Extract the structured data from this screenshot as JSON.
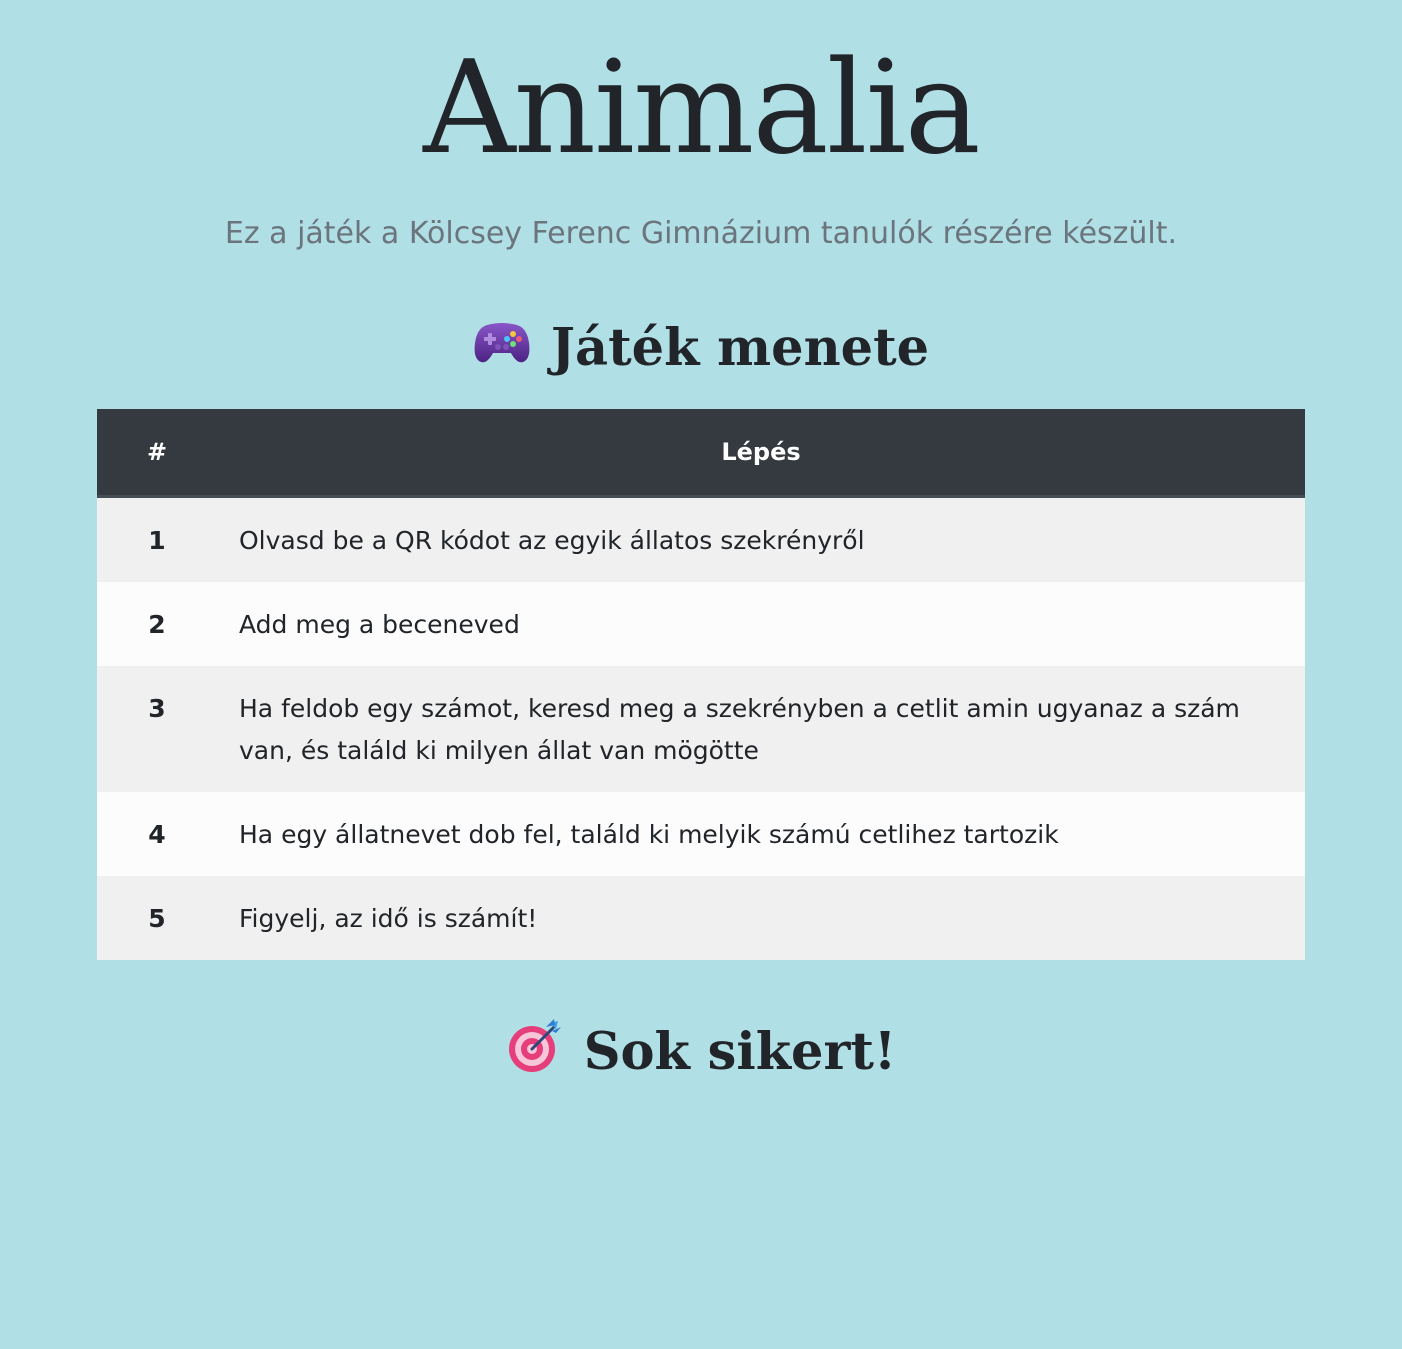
{
  "header": {
    "title": "Animalia",
    "subtitle": "Ez a játék a Kölcsey Ferenc Gimnázium tanulók részére készült."
  },
  "game_section": {
    "icon": "game-controller-icon",
    "title": "Játék menete"
  },
  "steps_table": {
    "columns": [
      "#",
      "Lépés"
    ],
    "rows": [
      {
        "num": "1",
        "text": "Olvasd be a QR kódot az egyik állatos szekrényről"
      },
      {
        "num": "2",
        "text": "Add meg a beceneved"
      },
      {
        "num": "3",
        "text": "Ha feldob egy számot, keresd meg a szekrényben a cetlit amin ugyanaz a szám van, és találd ki milyen állat van mögötte"
      },
      {
        "num": "4",
        "text": "Ha egy állatnevet dob fel, találd ki melyik számú cetlihez tartozik"
      },
      {
        "num": "5",
        "text": "Figyelj, az idő is számít!"
      }
    ],
    "header_bg": "#343a40",
    "row_odd_bg": "#f0f0f0",
    "row_even_bg": "#fcfcfc"
  },
  "closing_section": {
    "icon": "dart-target-icon",
    "title": "Sok sikert!"
  },
  "colors": {
    "page_bg": "#b0dfe5",
    "text": "#212529",
    "muted": "#6c757d"
  }
}
